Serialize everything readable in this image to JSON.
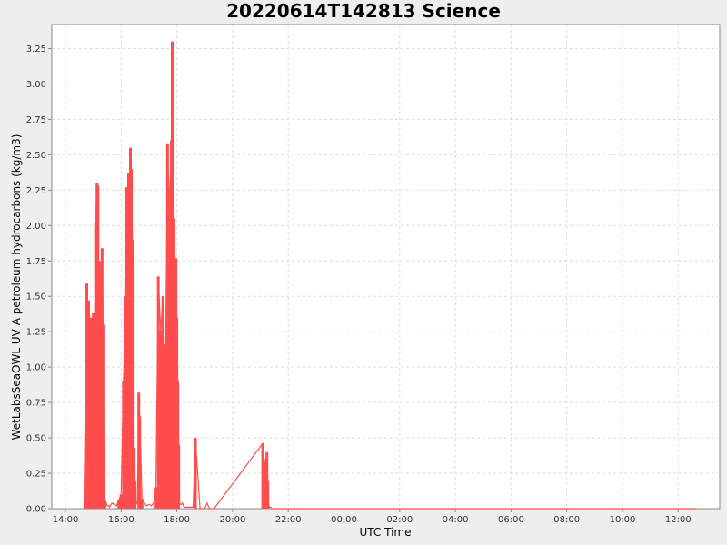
{
  "chart_data": {
    "type": "line",
    "title": "20220614T142813 Science",
    "xlabel": "UTC Time",
    "ylabel": "WetLabsSeaOWL UV A petroleum hydrocarbons (kg/m3)",
    "x_tick_labels": [
      "14:00",
      "16:00",
      "18:00",
      "20:00",
      "22:00",
      "00:00",
      "02:00",
      "04:00",
      "06:00",
      "08:00",
      "10:00",
      "12:00"
    ],
    "y_tick_labels": [
      "0.00",
      "0.25",
      "0.50",
      "0.75",
      "1.00",
      "1.25",
      "1.50",
      "1.75",
      "2.00",
      "2.25",
      "2.50",
      "2.75",
      "3.00",
      "3.25"
    ],
    "ylim": [
      0,
      3.42
    ],
    "grid": true,
    "legend": "none",
    "series": [
      {
        "color": "#ff4d4d",
        "x": [
          "14:40",
          "14:46",
          "14:47",
          "14:48",
          "14:50",
          "14:52",
          "14:55",
          "14:58",
          "15:00",
          "15:03",
          "15:05",
          "15:08",
          "15:10",
          "15:12",
          "15:14",
          "15:15",
          "15:17",
          "15:19",
          "15:21",
          "15:23",
          "15:25",
          "15:27",
          "15:30",
          "15:33",
          "15:35",
          "15:40",
          "15:45",
          "15:50",
          "15:55",
          "16:00",
          "16:05",
          "16:10",
          "16:12",
          "16:14",
          "16:16",
          "16:18",
          "16:20",
          "16:22",
          "16:24",
          "16:26",
          "16:28",
          "16:30",
          "16:32",
          "16:35",
          "16:38",
          "16:40",
          "16:45",
          "16:50",
          "16:55",
          "17:00",
          "17:05",
          "17:10",
          "17:15",
          "17:20",
          "17:25",
          "17:30",
          "17:33",
          "17:36",
          "17:40",
          "17:44",
          "17:48",
          "17:50",
          "17:52",
          "17:54",
          "17:56",
          "17:58",
          "18:00",
          "18:02",
          "18:04",
          "18:06",
          "18:08",
          "18:10",
          "18:12",
          "18:14",
          "18:16",
          "18:20",
          "18:25",
          "18:30",
          "18:35",
          "18:40",
          "18:50",
          "19:00",
          "19:05",
          "19:10",
          "19:15",
          "19:20",
          "21:05",
          "21:10",
          "21:12",
          "21:14",
          "21:16",
          "21:18",
          "21:20",
          "21:22",
          "21:25",
          "21:40",
          "22:00",
          "23:00",
          "00:00",
          "02:00",
          "04:00",
          "06:00",
          "08:00",
          "10:00",
          "12:00",
          "12:40"
        ],
        "y": [
          0.0,
          1.59,
          0.4,
          0.98,
          1.47,
          0.1,
          1.35,
          0.04,
          1.38,
          0.7,
          2.02,
          2.3,
          2.28,
          1.4,
          0.9,
          1.75,
          0.2,
          1.84,
          1.3,
          0.4,
          0.06,
          0.05,
          0.02,
          0.02,
          0.01,
          0.04,
          0.03,
          0.02,
          0.06,
          0.1,
          0.9,
          1.5,
          2.27,
          2.0,
          2.37,
          1.68,
          2.55,
          2.4,
          1.9,
          1.7,
          0.43,
          0.2,
          0.05,
          0.03,
          0.82,
          0.65,
          0.07,
          0.04,
          0.02,
          0.03,
          0.02,
          0.04,
          0.15,
          1.64,
          1.26,
          1.5,
          0.9,
          1.16,
          2.58,
          2.1,
          2.6,
          3.3,
          2.7,
          2.05,
          1.3,
          1.77,
          1.35,
          0.9,
          0.45,
          0.04,
          0.03,
          0.03,
          0.04,
          0.02,
          0.01,
          0.01,
          0.01,
          0.01,
          0.01,
          0.5,
          0.0,
          0.0,
          0.04,
          0.0,
          0.0,
          0.0,
          0.46,
          0.25,
          0.35,
          0.4,
          0.2,
          0.01,
          0.01,
          0.01,
          0.0,
          0.0,
          0.0,
          0.0,
          0.0,
          0.0,
          0.0,
          0.0,
          0.0,
          0.0,
          0.0,
          0.0
        ]
      }
    ]
  }
}
